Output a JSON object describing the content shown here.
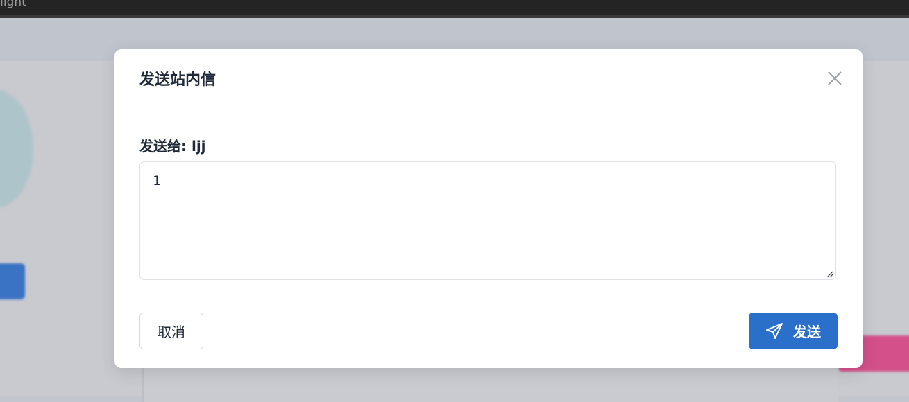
{
  "window": {
    "title_fragment": "-light"
  },
  "dialog": {
    "title": "发送站内信",
    "recipient_label": "发送给:",
    "recipient_name": "ljj",
    "message_value": "1",
    "cancel_label": "取消",
    "send_label": "发送"
  },
  "colors": {
    "primary": "#2a6fc9",
    "overlay": "#c8cad0",
    "topbar": "#242424"
  },
  "icons": {
    "close": "close-icon",
    "send": "paper-plane-icon"
  }
}
